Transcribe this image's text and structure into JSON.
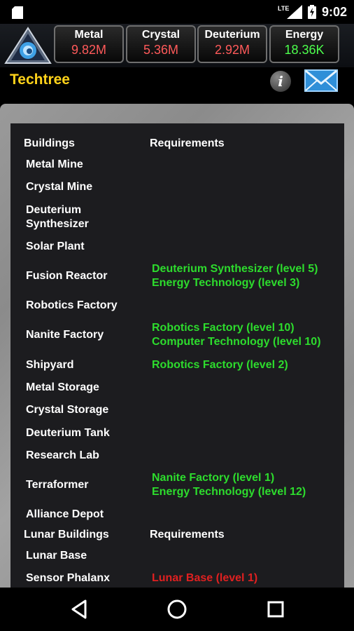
{
  "status_bar": {
    "time": "9:02",
    "network": "LTE"
  },
  "resources": [
    {
      "name": "Metal",
      "value": "9.82M",
      "color": "#ff5a5a"
    },
    {
      "name": "Crystal",
      "value": "5.36M",
      "color": "#ff5a5a"
    },
    {
      "name": "Deuterium",
      "value": "2.92M",
      "color": "#ff5a5a"
    },
    {
      "name": "Energy",
      "value": "18.36K",
      "color": "#4dff4d"
    }
  ],
  "page": {
    "title": "Techtree",
    "info_icon": "info-icon",
    "mail_icon": "mail-icon"
  },
  "sections": [
    {
      "header": "Buildings",
      "req_header": "Requirements",
      "items": [
        {
          "name": [
            "Metal Mine"
          ],
          "reqs": []
        },
        {
          "name": [
            "Crystal Mine"
          ],
          "reqs": []
        },
        {
          "name": [
            "Deuterium",
            "Synthesizer"
          ],
          "reqs": []
        },
        {
          "name": [
            "Solar Plant"
          ],
          "reqs": []
        },
        {
          "name": [
            "Fusion Reactor"
          ],
          "reqs": [
            "Deuterium Synthesizer (level 5)",
            "Energy Technology (level 3)"
          ]
        },
        {
          "name": [
            "Robotics Factory"
          ],
          "reqs": []
        },
        {
          "name": [
            "Nanite Factory"
          ],
          "reqs": [
            "Robotics Factory (level 10)",
            "Computer Technology (level 10)"
          ]
        },
        {
          "name": [
            "Shipyard"
          ],
          "reqs": [
            "Robotics Factory (level 2)"
          ]
        },
        {
          "name": [
            "Metal Storage"
          ],
          "reqs": []
        },
        {
          "name": [
            "Crystal Storage"
          ],
          "reqs": []
        },
        {
          "name": [
            "Deuterium Tank"
          ],
          "reqs": []
        },
        {
          "name": [
            "Research Lab"
          ],
          "reqs": []
        },
        {
          "name": [
            "Terraformer"
          ],
          "reqs": [
            "Nanite Factory (level 1)",
            "Energy Technology (level 12)"
          ]
        },
        {
          "name": [
            "Alliance Depot"
          ],
          "reqs": []
        }
      ]
    },
    {
      "header": "Lunar Buildings",
      "req_header": "Requirements",
      "items": [
        {
          "name": [
            "Lunar Base"
          ],
          "reqs": []
        },
        {
          "name": [
            "Sensor Phalanx"
          ],
          "reqs": [
            "Lunar Base (level 1)"
          ],
          "unmet": true
        }
      ]
    }
  ],
  "nav": {
    "back": "back-icon",
    "home": "home-icon",
    "recents": "recents-icon"
  }
}
